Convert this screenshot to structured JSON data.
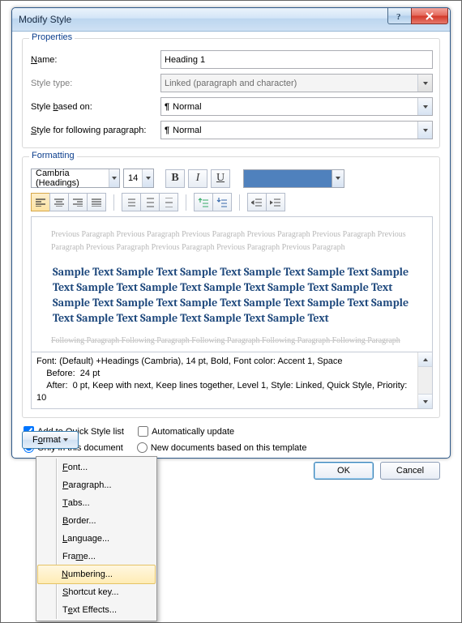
{
  "window": {
    "title": "Modify Style"
  },
  "properties": {
    "legend": "Properties",
    "name_label": "Name:",
    "name_value": "Heading 1",
    "type_label": "Style type:",
    "type_value": "Linked (paragraph and character)",
    "based_label": "Style based on:",
    "based_value": "Normal",
    "following_label": "Style for following paragraph:",
    "following_value": "Normal"
  },
  "formatting": {
    "legend": "Formatting",
    "font": "Cambria (Headings)",
    "size": "14",
    "accent_color": "#4f81bd",
    "preview_grey": "Previous Paragraph Previous Paragraph Previous Paragraph Previous Paragraph Previous Paragraph Previous Paragraph Previous Paragraph Previous Paragraph Previous Paragraph Previous Paragraph",
    "preview_sample": "Sample Text Sample Text Sample Text Sample Text Sample Text Sample Text Sample Text Sample Text Sample Text Sample Text Sample Text Sample Text Sample Text Sample Text Sample Text Sample Text Sample Text Sample Text Sample Text Sample Text Sample Text",
    "preview_following": "Following Paragraph Following Paragraph Following Paragraph Following Paragraph Following Paragraph",
    "summary_l1": "Font: (Default) +Headings (Cambria), 14 pt, Bold, Font color: Accent 1, Space",
    "summary_l2": "    Before:  24 pt",
    "summary_l3": "    After:  0 pt, Keep with next, Keep lines together, Level 1, Style: Linked, Quick Style, Priority: 10"
  },
  "checks": {
    "quickstyle": "Add to Quick Style list",
    "autoupdate": "Automatically update",
    "onlydoc": "Only in this document",
    "template": "New documents based on this template"
  },
  "buttons": {
    "format": "Format",
    "ok": "OK",
    "cancel": "Cancel"
  },
  "menu": {
    "font": "Font...",
    "paragraph": "Paragraph...",
    "tabs": "Tabs...",
    "border": "Border...",
    "language": "Language...",
    "frame": "Frame...",
    "numbering": "Numbering...",
    "shortcut": "Shortcut key...",
    "effects": "Text Effects..."
  }
}
